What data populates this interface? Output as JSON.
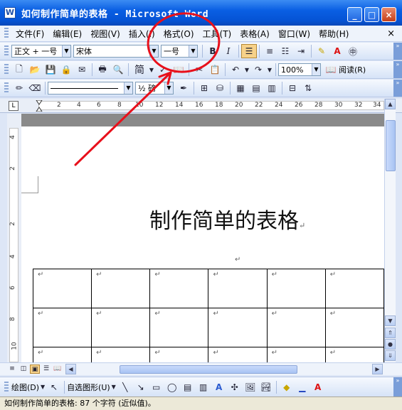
{
  "window": {
    "title": "如何制作简单的表格 - Microsoft Word",
    "app_icon": "W",
    "controls": {
      "minimize": "_",
      "maximize": "□",
      "close": "×"
    }
  },
  "menubar": {
    "items": [
      "文件(F)",
      "编辑(E)",
      "视图(V)",
      "插入(I)",
      "格式(O)",
      "工具(T)",
      "表格(A)",
      "窗口(W)",
      "帮助(H)"
    ],
    "close": "×"
  },
  "format_toolbar": {
    "style": "正文 + 一号",
    "font": "宋体",
    "size": "一号",
    "bold": "B",
    "italic": "I"
  },
  "standard_toolbar": {
    "chinese_convert": "简",
    "zoom": "100%",
    "read_label": "阅读(R)"
  },
  "table_toolbar": {
    "line_weight": "½ 磅"
  },
  "ruler": {
    "tab_marker": "L",
    "h_ticks": [
      "2",
      "4",
      "6",
      "8",
      "10",
      "12",
      "14",
      "16",
      "18",
      "20",
      "22",
      "24",
      "26",
      "28",
      "30",
      "32",
      "34"
    ],
    "v_ticks": [
      "4",
      "2",
      "2",
      "4",
      "6",
      "8",
      "10"
    ]
  },
  "document": {
    "title": "制作简单的表格",
    "para_mark": "↵",
    "table_rows": 3,
    "table_cols": 6
  },
  "drawbar": {
    "draw_label": "绘图(D)",
    "autoshape_label": "自选图形(U)"
  },
  "status": {
    "text": "如何制作简单的表格: 87 个字符 (近似值)。"
  },
  "annotation": {
    "color": "#e8101b",
    "target": "格式(O)"
  }
}
